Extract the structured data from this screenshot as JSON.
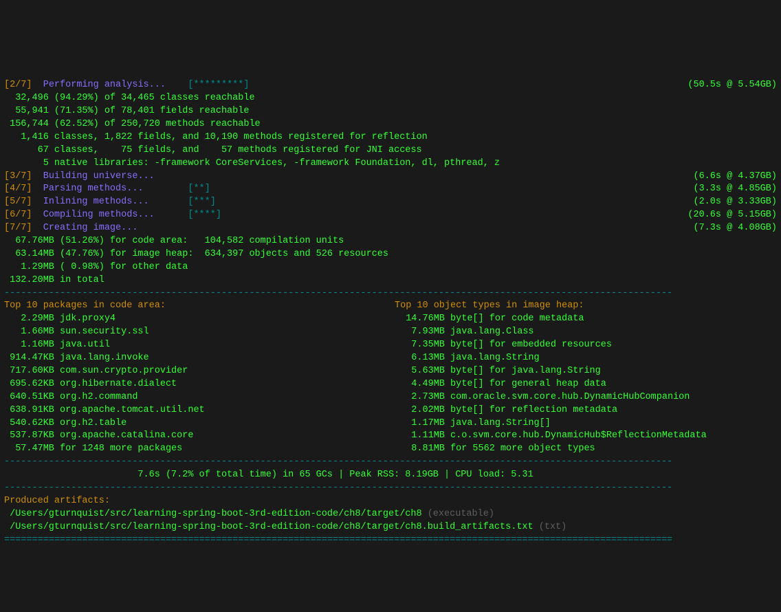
{
  "steps": [
    {
      "marker": "[2/7]",
      "label": "Performing analysis...",
      "progress": "[*********]",
      "timing": "(50.5s @ 5.54GB)",
      "detail": [
        "  32,496 (94.29%) of 34,465 classes reachable",
        "  55,941 (71.35%) of 78,401 fields reachable",
        " 156,744 (62.52%) of 250,720 methods reachable",
        "   1,416 classes, 1,822 fields, and 10,190 methods registered for reflection",
        "      67 classes,    75 fields, and    57 methods registered for JNI access",
        "       5 native libraries: -framework CoreServices, -framework Foundation, dl, pthread, z"
      ]
    },
    {
      "marker": "[3/7]",
      "label": "Building universe...",
      "progress": "",
      "timing": "(6.6s @ 4.37GB)",
      "detail": []
    },
    {
      "marker": "[4/7]",
      "label": "Parsing methods...",
      "progress": "[**]",
      "timing": "(3.3s @ 4.85GB)",
      "detail": []
    },
    {
      "marker": "[5/7]",
      "label": "Inlining methods...",
      "progress": "[***]",
      "timing": "(2.0s @ 3.33GB)",
      "detail": []
    },
    {
      "marker": "[6/7]",
      "label": "Compiling methods...",
      "progress": "[****]",
      "timing": "(20.6s @ 5.15GB)",
      "detail": []
    },
    {
      "marker": "[7/7]",
      "label": "Creating image...",
      "progress": "",
      "timing": "(7.3s @ 4.08GB)",
      "detail": [
        "  67.76MB (51.26%) for code area:   104,582 compilation units",
        "  63.14MB (47.76%) for image heap:  634,397 objects and 526 resources",
        "   1.29MB ( 0.98%) for other data",
        " 132.20MB in total"
      ]
    }
  ],
  "sep": "------------------------------------------------------------------------------------------------------------------------",
  "dsep": "========================================================================================================================",
  "left_title": "Top 10 packages in code area:",
  "right_title": "Top 10 object types in image heap:",
  "left_items": [
    [
      "   2.29MB",
      "jdk.proxy4"
    ],
    [
      "   1.66MB",
      "sun.security.ssl"
    ],
    [
      "   1.16MB",
      "java.util"
    ],
    [
      " 914.47KB",
      "java.lang.invoke"
    ],
    [
      " 717.60KB",
      "com.sun.crypto.provider"
    ],
    [
      " 695.62KB",
      "org.hibernate.dialect"
    ],
    [
      " 640.51KB",
      "org.h2.command"
    ],
    [
      " 638.91KB",
      "org.apache.tomcat.util.net"
    ],
    [
      " 540.62KB",
      "org.h2.table"
    ],
    [
      " 537.87KB",
      "org.apache.catalina.core"
    ],
    [
      "  57.47MB",
      "for 1248 more packages"
    ]
  ],
  "right_items": [
    [
      "  14.76MB",
      "byte[] for code metadata"
    ],
    [
      "   7.93MB",
      "java.lang.Class"
    ],
    [
      "   7.35MB",
      "byte[] for embedded resources"
    ],
    [
      "   6.13MB",
      "java.lang.String"
    ],
    [
      "   5.63MB",
      "byte[] for java.lang.String"
    ],
    [
      "   4.49MB",
      "byte[] for general heap data"
    ],
    [
      "   2.73MB",
      "com.oracle.svm.core.hub.DynamicHubCompanion"
    ],
    [
      "   2.02MB",
      "byte[] for reflection metadata"
    ],
    [
      "   1.17MB",
      "java.lang.String[]"
    ],
    [
      "   1.11MB",
      "c.o.svm.core.hub.DynamicHub$ReflectionMetadata"
    ],
    [
      "   8.81MB",
      "for 5562 more object types"
    ]
  ],
  "gc_line": "                        7.6s (7.2% of total time) in 65 GCs | Peak RSS: 8.19GB | CPU load: 5.31",
  "produced_title": "Produced artifacts:",
  "artifacts": [
    {
      "path": " /Users/gturnquist/src/learning-spring-boot-3rd-edition-code/ch8/target/ch8",
      "kind": " (executable)"
    },
    {
      "path": " /Users/gturnquist/src/learning-spring-boot-3rd-edition-code/ch8/target/ch8.build_artifacts.txt",
      "kind": " (txt)"
    }
  ],
  "ghost": {
    "p1": "",
    "h2": "",
    "p2": ""
  }
}
